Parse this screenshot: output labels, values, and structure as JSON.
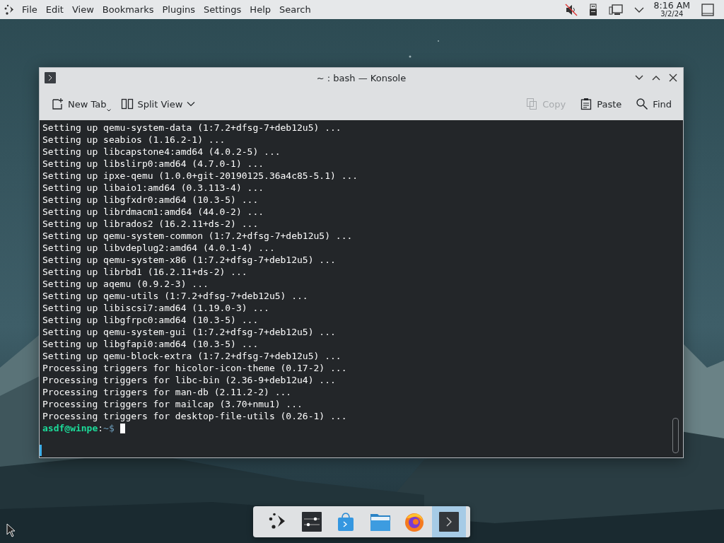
{
  "top_panel": {
    "menu": [
      "File",
      "Edit",
      "View",
      "Bookmarks",
      "Plugins",
      "Settings",
      "Help",
      "Search"
    ],
    "tray": [
      {
        "kind": "speaker-muted"
      },
      {
        "kind": "usb"
      },
      {
        "kind": "network"
      },
      {
        "kind": "expand"
      }
    ],
    "clock": {
      "time": "8:16 AM",
      "date": "3/2/24"
    }
  },
  "window": {
    "title": "~ : bash — Konsole",
    "toolbar": [
      {
        "kind": "new-tab",
        "label": "New Tab",
        "disabled": false
      },
      {
        "kind": "split-view",
        "label": "Split View",
        "disabled": false
      },
      {
        "kind": "copy",
        "label": "Copy",
        "disabled": true
      },
      {
        "kind": "paste",
        "label": "Paste",
        "disabled": false
      },
      {
        "kind": "find",
        "label": "Find",
        "disabled": false
      }
    ],
    "terminal": {
      "lines": [
        "Setting up qemu-system-data (1:7.2+dfsg-7+deb12u5) ...",
        "Setting up seabios (1.16.2-1) ...",
        "Setting up libcapstone4:amd64 (4.0.2-5) ...",
        "Setting up libslirp0:amd64 (4.7.0-1) ...",
        "Setting up ipxe-qemu (1.0.0+git-20190125.36a4c85-5.1) ...",
        "Setting up libaio1:amd64 (0.3.113-4) ...",
        "Setting up libgfxdr0:amd64 (10.3-5) ...",
        "Setting up librdmacm1:amd64 (44.0-2) ...",
        "Setting up librados2 (16.2.11+ds-2) ...",
        "Setting up qemu-system-common (1:7.2+dfsg-7+deb12u5) ...",
        "Setting up libvdeplug2:amd64 (4.0.1-4) ...",
        "Setting up qemu-system-x86 (1:7.2+dfsg-7+deb12u5) ...",
        "Setting up librbd1 (16.2.11+ds-2) ...",
        "Setting up aqemu (0.9.2-3) ...",
        "Setting up qemu-utils (1:7.2+dfsg-7+deb12u5) ...",
        "Setting up libiscsi7:amd64 (1.19.0-3) ...",
        "Setting up libgfrpc0:amd64 (10.3-5) ...",
        "Setting up qemu-system-gui (1:7.2+dfsg-7+deb12u5) ...",
        "Setting up libgfapi0:amd64 (10.3-5) ...",
        "Setting up qemu-block-extra (1:7.2+dfsg-7+deb12u5) ...",
        "Processing triggers for hicolor-icon-theme (0.17-2) ...",
        "Processing triggers for libc-bin (2.36-9+deb12u4) ...",
        "Processing triggers for man-db (2.11.2-2) ...",
        "Processing triggers for mailcap (3.70+nmu1) ...",
        "Processing triggers for desktop-file-utils (0.26-1) ..."
      ],
      "prompt": {
        "user_host": "asdf@winpe",
        "separator": ":",
        "path": "~$"
      }
    }
  },
  "taskbar": {
    "items": [
      {
        "kind": "launcher",
        "selected": false
      },
      {
        "kind": "settings",
        "selected": false
      },
      {
        "kind": "store",
        "selected": false
      },
      {
        "kind": "files",
        "selected": false
      },
      {
        "kind": "browser",
        "selected": false
      },
      {
        "kind": "terminal",
        "selected": true
      }
    ]
  }
}
